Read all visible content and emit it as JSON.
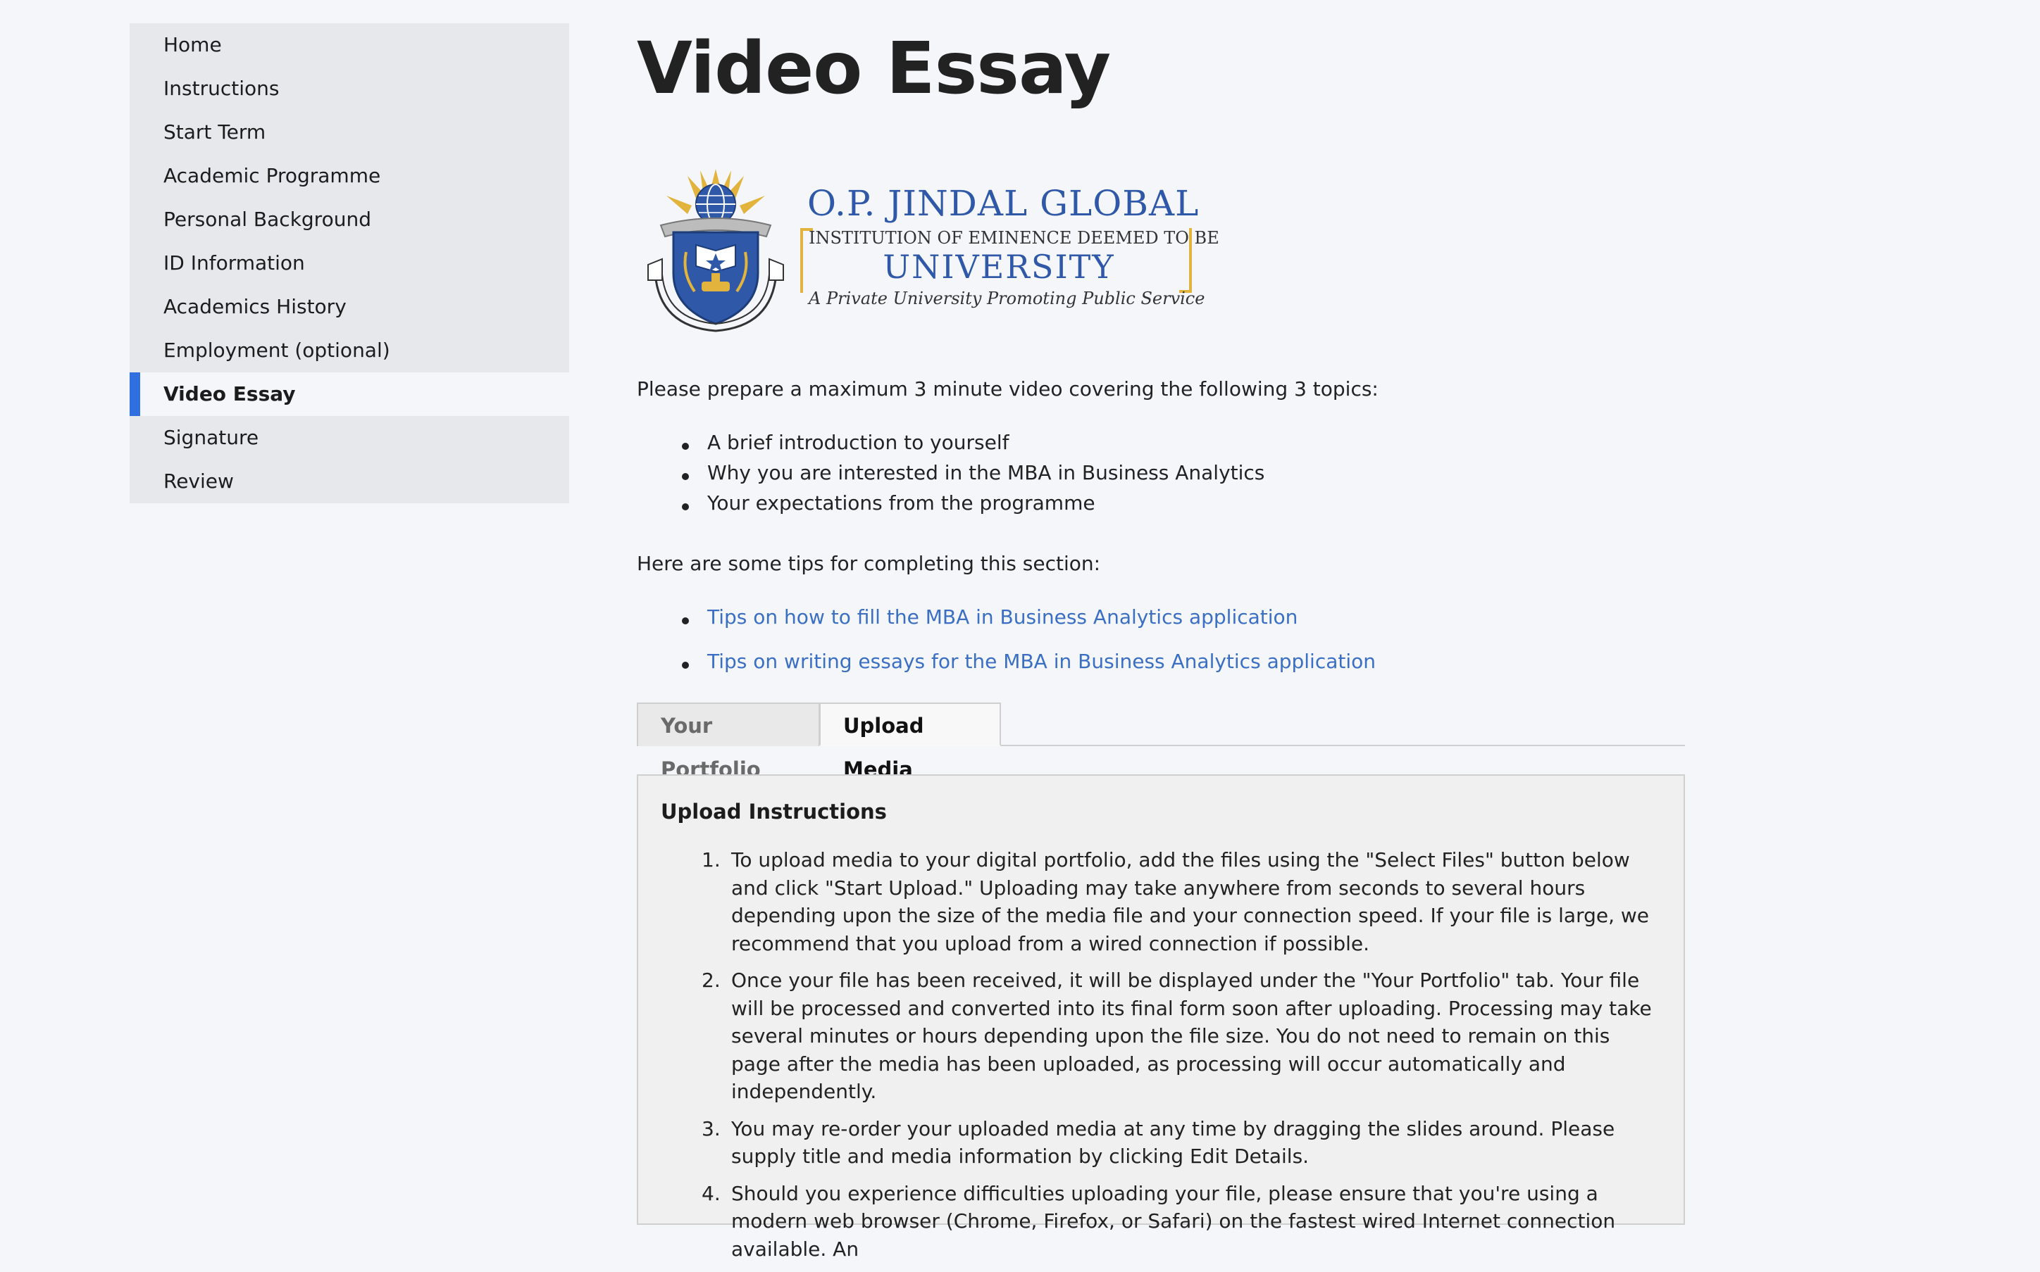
{
  "sidebar": {
    "items": [
      {
        "label": "Home"
      },
      {
        "label": "Instructions"
      },
      {
        "label": "Start Term"
      },
      {
        "label": "Academic Programme"
      },
      {
        "label": "Personal Background"
      },
      {
        "label": "ID Information"
      },
      {
        "label": "Academics History"
      },
      {
        "label": "Employment (optional)"
      },
      {
        "label": "Video Essay",
        "active": true
      },
      {
        "label": "Signature"
      },
      {
        "label": "Review"
      }
    ]
  },
  "main": {
    "title": "Video Essay",
    "logo": {
      "name": "O.P. JINDAL GLOBAL",
      "line1": "INSTITUTION OF EMINENCE DEEMED TO BE",
      "line2": "UNIVERSITY",
      "tagline": "A Private University Promoting Public Service",
      "seal_text": "O.P. JINDAL GLOBAL UNIVERSITY",
      "colors": {
        "blue": "#2f59a8",
        "gold": "#e2b33d"
      }
    },
    "intro": "Please prepare a maximum 3 minute video covering the following 3 topics:",
    "topics": [
      "A brief introduction to yourself",
      "Why you are interested in the MBA in Business Analytics",
      "Your expectations from the programme"
    ],
    "tips_intro": "Here are some tips for completing this section:",
    "tips_links": [
      "Tips on how to fill the MBA in Business Analytics application",
      "Tips on writing essays for the MBA in Business Analytics application"
    ],
    "tabs": [
      {
        "label": "Your Portfolio",
        "active": false
      },
      {
        "label": "Upload Media",
        "active": true
      }
    ],
    "upload": {
      "title": "Upload Instructions",
      "steps": [
        {
          "num": "1.",
          "text": "To upload media to your digital portfolio, add the files using the \"Select Files\" button below and click \"Start Upload.\" Uploading may take anywhere from seconds to several hours depending upon the size of the media file and your connection speed. If your file is large, we recommend that you upload from a wired connection if possible."
        },
        {
          "num": "2.",
          "text": "Once your file has been received, it will be displayed under the \"Your Portfolio\" tab. Your file will be processed and converted into its final form soon after uploading. Processing may take several minutes or hours depending upon the file size. You do not need to remain on this page after the media has been uploaded, as processing will occur automatically and independently."
        },
        {
          "num": "3.",
          "text": "You may re-order your uploaded media at any time by dragging the slides around. Please supply title and media information by clicking Edit Details."
        },
        {
          "num": "4.",
          "text": "Should you experience difficulties uploading your file, please ensure that you're using a modern web browser (Chrome, Firefox, or Safari) on the fastest wired Internet connection available. An"
        }
      ]
    }
  },
  "colors": {
    "background": "#f4f6f9",
    "sidebar_bg": "#e6e8ec",
    "active_marker": "#2f6fe0",
    "link": "#3a6fc4"
  }
}
